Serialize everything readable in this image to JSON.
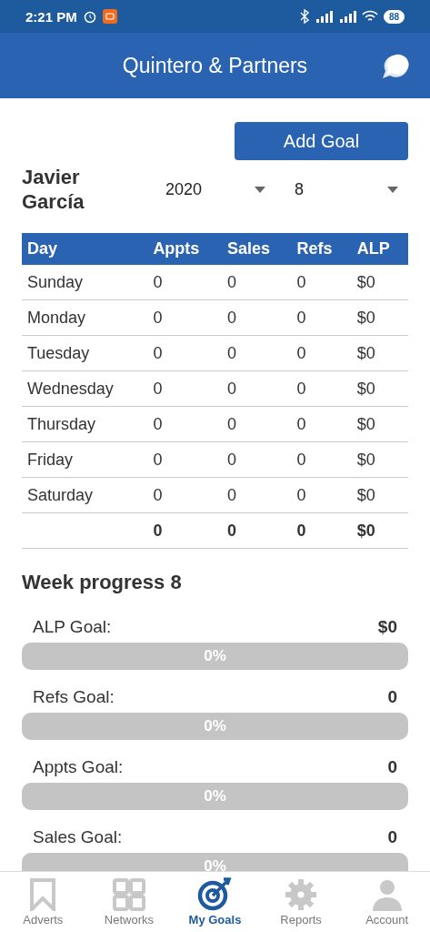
{
  "status_bar": {
    "time": "2:21 PM",
    "battery": "88"
  },
  "app_bar": {
    "title": "Quintero & Partners"
  },
  "add_goal_button": "Add Goal",
  "agent_name": "Javier García",
  "year_select": {
    "value": "2020"
  },
  "week_select": {
    "value": "8"
  },
  "table": {
    "columns": [
      "Day",
      "Appts",
      "Sales",
      "Refs",
      "ALP"
    ],
    "rows": [
      [
        "Sunday",
        "0",
        "0",
        "0",
        "$0"
      ],
      [
        "Monday",
        "0",
        "0",
        "0",
        "$0"
      ],
      [
        "Tuesday",
        "0",
        "0",
        "0",
        "$0"
      ],
      [
        "Wednesday",
        "0",
        "0",
        "0",
        "$0"
      ],
      [
        "Thursday",
        "0",
        "0",
        "0",
        "$0"
      ],
      [
        "Friday",
        "0",
        "0",
        "0",
        "$0"
      ],
      [
        "Saturday",
        "0",
        "0",
        "0",
        "$0"
      ]
    ],
    "totals": [
      "0",
      "0",
      "0",
      "$0"
    ]
  },
  "progress_title": "Week progress 8",
  "goals": [
    {
      "label": "ALP Goal:",
      "value": "$0",
      "level": 0,
      "percent": "0%"
    },
    {
      "label": "Refs Goal:",
      "value": "0",
      "level": 0,
      "percent": "0%"
    },
    {
      "label": "Appts Goal:",
      "value": "0",
      "level": 0,
      "percent": "0%"
    },
    {
      "label": "Sales Goal:",
      "value": "0",
      "level": 0,
      "percent": "0%"
    }
  ],
  "nav": [
    {
      "kind": "bookmark",
      "label": "Adverts",
      "selected": false
    },
    {
      "kind": "grid",
      "label": "Networks",
      "selected": false
    },
    {
      "kind": "target",
      "label": "My Goals",
      "selected": true
    },
    {
      "kind": "gear",
      "label": "Reports",
      "selected": false
    },
    {
      "kind": "person",
      "label": "Account",
      "selected": false
    }
  ]
}
